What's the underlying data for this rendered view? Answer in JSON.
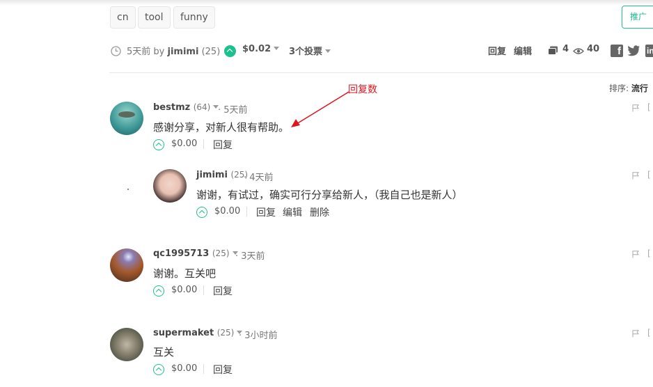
{
  "tags": [
    "cn",
    "tool",
    "funny"
  ],
  "promote_label": "推广",
  "post_meta": {
    "time_ago": "5天前",
    "by": "by",
    "author": "jimimi",
    "author_rep": "(25)",
    "payout": "$0.02",
    "votes": "3个投票",
    "reply": "回复",
    "edit": "编辑",
    "comment_count": "4",
    "view_count": "40"
  },
  "annotation": "回复数",
  "sort": {
    "label": "排序:",
    "value": "流行"
  },
  "comments": [
    {
      "author": "bestmz",
      "rep": "(64)",
      "time": "· 5天前",
      "body": "感谢分享，对新人很有帮助。",
      "payout": "$0.00",
      "reply": "回复"
    },
    {
      "author": "jimimi",
      "rep": "(25)",
      "time": "· 4天前",
      "body": "谢谢，有试过，确实可行分享给新人，（我自己也是新人）",
      "payout": "$0.00",
      "reply": "回复",
      "edit": "编辑",
      "delete": "删除"
    },
    {
      "author": "qc1995713",
      "rep": "(25)",
      "time": "· 3天前",
      "body": "谢谢。互关吧",
      "payout": "$0.00",
      "reply": "回复"
    },
    {
      "author": "supermaket",
      "rep": "(25)",
      "time": "· 3小时前",
      "body": "互关",
      "payout": "$0.00",
      "reply": "回复"
    }
  ],
  "colors": {
    "accent": "#1fbf8f",
    "annotation": "#e0161f"
  }
}
